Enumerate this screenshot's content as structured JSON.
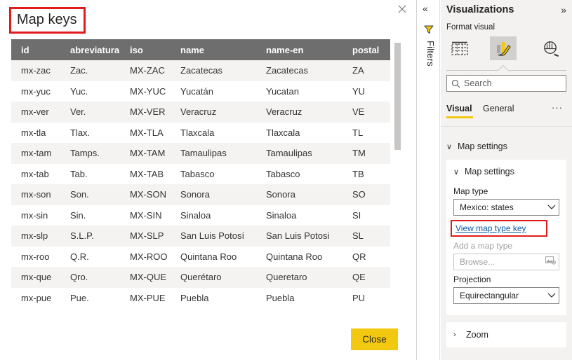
{
  "dialog": {
    "title": "Map keys",
    "close_x_icon": "close-icon",
    "close_button_label": "Close",
    "accent_color": "#f2c811",
    "highlight_color": "#e01b1b",
    "table": {
      "columns": [
        "id",
        "abreviatura",
        "iso",
        "name",
        "name-en",
        "postal"
      ],
      "rows": [
        [
          "mx-zac",
          "Zac.",
          "MX-ZAC",
          "Zacatecas",
          "Zacatecas",
          "ZA"
        ],
        [
          "mx-yuc",
          "Yuc.",
          "MX-YUC",
          "Yucatán",
          "Yucatan",
          "YU"
        ],
        [
          "mx-ver",
          "Ver.",
          "MX-VER",
          "Veracruz",
          "Veracruz",
          "VE"
        ],
        [
          "mx-tla",
          "Tlax.",
          "MX-TLA",
          "Tlaxcala",
          "Tlaxcala",
          "TL"
        ],
        [
          "mx-tam",
          "Tamps.",
          "MX-TAM",
          "Tamaulipas",
          "Tamaulipas",
          "TM"
        ],
        [
          "mx-tab",
          "Tab.",
          "MX-TAB",
          "Tabasco",
          "Tabasco",
          "TB"
        ],
        [
          "mx-son",
          "Son.",
          "MX-SON",
          "Sonora",
          "Sonora",
          "SO"
        ],
        [
          "mx-sin",
          "Sin.",
          "MX-SIN",
          "Sinaloa",
          "Sinaloa",
          "SI"
        ],
        [
          "mx-slp",
          "S.L.P.",
          "MX-SLP",
          "San Luis Potosí",
          "San Luis Potosi",
          "SL"
        ],
        [
          "mx-roo",
          "Q.R.",
          "MX-ROO",
          "Quintana Roo",
          "Quintana Roo",
          "QR"
        ],
        [
          "mx-que",
          "Qro.",
          "MX-QUE",
          "Querétaro",
          "Queretaro",
          "QE"
        ],
        [
          "mx-pue",
          "Pue.",
          "MX-PUE",
          "Puebla",
          "Puebla",
          "PU"
        ]
      ],
      "header_bg": "#6e6e6e",
      "alt_row_bg": "#f4f3f2"
    }
  },
  "filters_rail": {
    "collapse_icon": "chevron-double-left-icon",
    "collapse_glyph": "«",
    "filter_icon": "filter-icon",
    "label": "Filters"
  },
  "visualizations": {
    "title": "Visualizations",
    "expand_glyph": "»",
    "expand_icon": "chevron-double-right-icon",
    "subtitle": "Format visual",
    "icons": [
      {
        "name": "build-visual-icon",
        "label": "Build visual",
        "selected": false
      },
      {
        "name": "format-visual-icon",
        "label": "Format visual",
        "selected": true
      },
      {
        "name": "analytics-icon",
        "label": "Analytics",
        "selected": false
      }
    ],
    "search": {
      "placeholder": "Search",
      "value": "",
      "icon": "search-icon"
    },
    "tabs": [
      {
        "label": "Visual",
        "selected": true
      },
      {
        "label": "General",
        "selected": false
      }
    ],
    "more_glyph": "···",
    "group_header": {
      "label": "Map settings",
      "chevron": "∨",
      "expanded": true
    },
    "card": {
      "section_label": "Map settings",
      "section_chevron": "∨",
      "map_type": {
        "label": "Map type",
        "value": "Mexico: states",
        "chevron_icon": "chevron-down-icon"
      },
      "view_map_type_key": "View map type key",
      "add_map_type": {
        "label": "Add a map type",
        "placeholder": "Browse...",
        "icon": "browse-image-icon"
      },
      "projection": {
        "label": "Projection",
        "value": "Equirectangular",
        "chevron_icon": "chevron-down-icon"
      }
    },
    "zoom_card": {
      "label": "Zoom",
      "chevron": "›",
      "expanded": false
    }
  }
}
